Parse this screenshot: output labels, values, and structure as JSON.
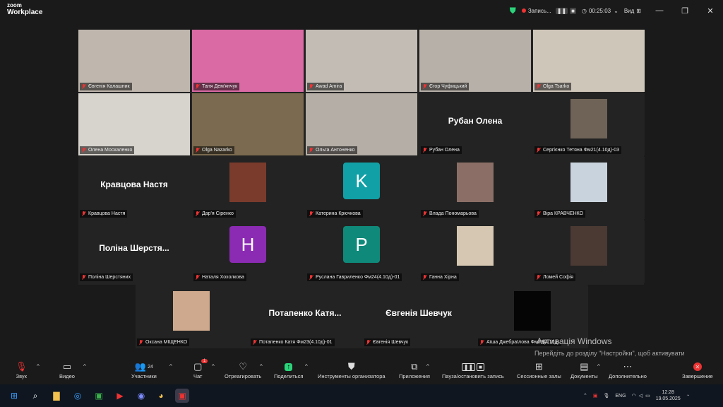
{
  "titlebar": {
    "logo_top": "zoom",
    "logo_bottom": "Workplace",
    "rec_label": "Запись...",
    "timer": "00:25:03",
    "view_label": "Вид"
  },
  "tiles": [
    {
      "name": "Євгенія Калашник",
      "type": "video",
      "bg": "#bfb7ae"
    },
    {
      "name": "Таня Дем'янчук",
      "type": "video",
      "bg": "#d96aa3"
    },
    {
      "name": "Awad Amira",
      "type": "video",
      "bg": "#c2bcb5"
    },
    {
      "name": "Єгор Чуфицький",
      "type": "video",
      "bg": "#b7b0a8"
    },
    {
      "name": "Olga Tsarko",
      "type": "video",
      "bg": "#cfc6ba"
    },
    {
      "name": "Олена Москаленко",
      "type": "video",
      "bg": "#d7d3cd"
    },
    {
      "name": "Olga Nazarko",
      "type": "video",
      "bg": "#7b6a4f",
      "active": true
    },
    {
      "name": "Ольга Антоненко",
      "type": "video",
      "bg": "#b5aea6"
    },
    {
      "name": "Рубан Олена",
      "type": "text",
      "big": "Рубан Олена"
    },
    {
      "name": "Сергієнко Тетяна Фм21(4.10д)-03",
      "type": "photo",
      "bg": "#6e6356"
    },
    {
      "name": "Кравцова Настя",
      "type": "text",
      "big": "Кравцова Настя"
    },
    {
      "name": "Дар'я Сіренко",
      "type": "photo",
      "bg": "#7a3a2c"
    },
    {
      "name": "Катерина Крючкова",
      "type": "letter",
      "letter": "K",
      "color": "#11a0a6"
    },
    {
      "name": "Влада Пономарьова",
      "type": "photo",
      "bg": "#8b6f66"
    },
    {
      "name": "Віра КРАВЧЕНКО",
      "type": "photo",
      "bg": "#c9d3dd"
    },
    {
      "name": "Поліна Шерстяних",
      "type": "text",
      "big": "Поліна Шерстя..."
    },
    {
      "name": "Наталя Хохолкова",
      "type": "letter",
      "letter": "H",
      "color": "#8b2bb3"
    },
    {
      "name": "Руслана Гавриленко Фм24(4.10д)-01",
      "type": "letter",
      "letter": "P",
      "color": "#0f8a7a"
    },
    {
      "name": "Ганна Хірна",
      "type": "photo",
      "bg": "#d6c7b2"
    },
    {
      "name": "Ломей Софія",
      "type": "photo",
      "bg": "#4a3a33"
    }
  ],
  "row5": [
    {
      "name": "Оксана МІЩЕНКО",
      "type": "photo",
      "bg": "#cfa98d"
    },
    {
      "name": "Потапенко Катя Фм23(4.10д)-01",
      "type": "text",
      "big": "Потапенко Катя..."
    },
    {
      "name": "Євгенія Шевчук",
      "type": "text",
      "big": "Євгенія Шевчук"
    },
    {
      "name": "Аїша Джебраїлова Фм23(4.10д)",
      "type": "photo",
      "bg": "#050505"
    }
  ],
  "watermark": {
    "title": "Активація Windows",
    "text": "Перейдіть до розділу \"Настройки\", щоб активувати Windows."
  },
  "toolbar": {
    "audio": "Звук",
    "video": "Видео",
    "participants": "Участники",
    "participants_count": "24",
    "chat": "Чат",
    "chat_badge": "1",
    "react": "Отреагировать",
    "share": "Поделиться",
    "host_tools": "Инструменты организатора",
    "apps": "Приложения",
    "record": "Пауза/остановить запись",
    "breakout": "Сессионные залы",
    "docs": "Документы",
    "more": "Дополнительно",
    "end": "Завершение"
  },
  "tray": {
    "lang": "ENG",
    "time": "12:28",
    "date": "19.05.2025"
  }
}
